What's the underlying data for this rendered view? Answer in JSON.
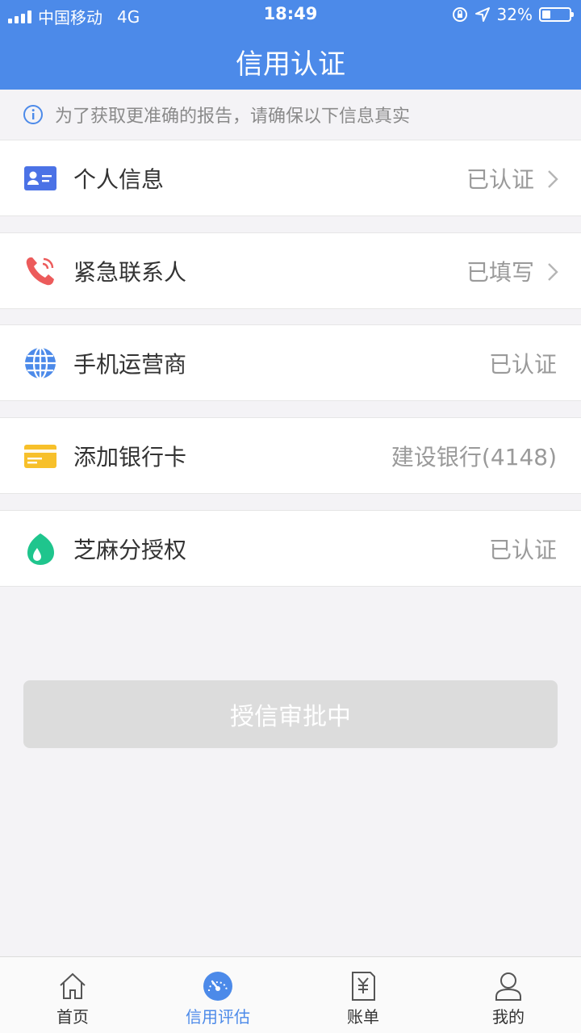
{
  "status_bar": {
    "carrier": "中国移动",
    "network": "4G",
    "time": "18:49",
    "battery": "32%"
  },
  "header": {
    "title": "信用认证"
  },
  "notice": {
    "text": "为了获取更准确的报告，请确保以下信息真实"
  },
  "items": [
    {
      "label": "个人信息",
      "value": "已认证",
      "icon": "id-card-icon",
      "has_chevron": true
    },
    {
      "label": "紧急联系人",
      "value": "已填写",
      "icon": "phone-icon",
      "has_chevron": true
    },
    {
      "label": "手机运营商",
      "value": "已认证",
      "icon": "globe-icon",
      "has_chevron": false
    },
    {
      "label": "添加银行卡",
      "value": "建设银行(4148)",
      "icon": "bank-card-icon",
      "has_chevron": false
    },
    {
      "label": "芝麻分授权",
      "value": "已认证",
      "icon": "sesame-icon",
      "has_chevron": false
    }
  ],
  "action_button": {
    "label": "授信审批中"
  },
  "tabbar": [
    {
      "label": "首页",
      "icon": "home-icon"
    },
    {
      "label": "信用评估",
      "icon": "gauge-icon",
      "active": true
    },
    {
      "label": "账单",
      "icon": "bill-icon"
    },
    {
      "label": "我的",
      "icon": "user-icon"
    }
  ],
  "colors": {
    "primary": "#4c8ae9",
    "background": "#f4f3f6",
    "value_text": "#9a9a9a",
    "button_disabled": "#dcdcdc"
  }
}
